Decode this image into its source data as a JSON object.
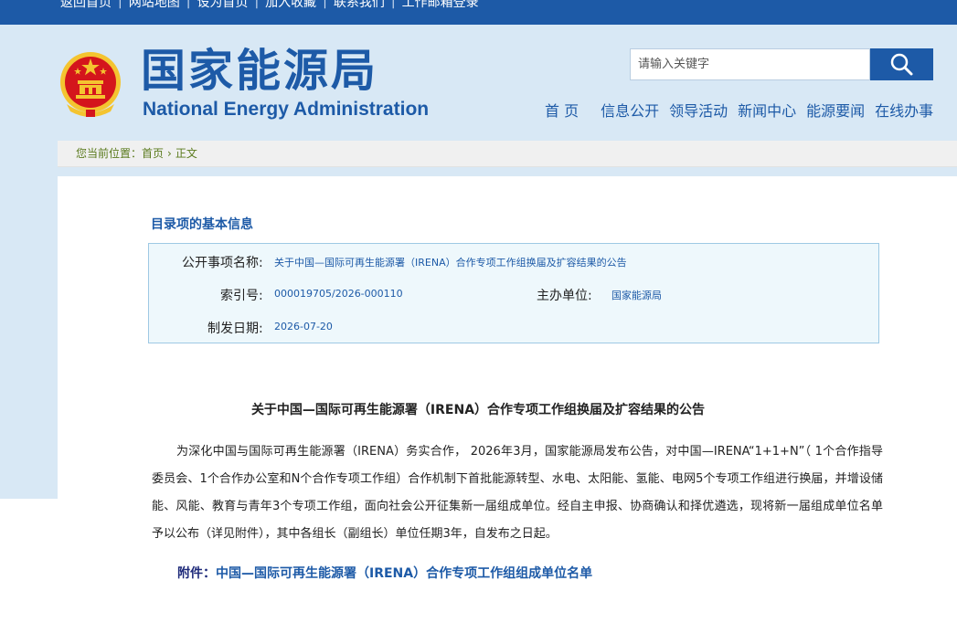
{
  "topbar": {
    "links": [
      "返回首页",
      "网站地图",
      "设为首页",
      "加入收藏",
      "联系我们",
      "工作邮箱登录"
    ],
    "separator": "|"
  },
  "header": {
    "logo_cn": "国家能源局",
    "logo_en": "National Energy Administration",
    "emblem_icon": "national-emblem-icon",
    "search": {
      "placeholder": "请输入关键字",
      "button_icon": "search-icon"
    },
    "nav": [
      "首 页",
      "信息公开",
      "领导活动",
      "新闻中心",
      "能源要闻",
      "在线办事"
    ]
  },
  "breadcrumb": {
    "prefix": "您当前位置：",
    "items": [
      "首页",
      "正文"
    ],
    "chevron_icon": "chevron-right-icon"
  },
  "info": {
    "title": "目录项的基本信息",
    "name_label": "公开事项名称:",
    "name_value": "关于中国—国际可再生能源署（IRENA）合作专项工作组换届及扩容结果的公告",
    "index_label": "索引号:",
    "index_value": "000019705/2026-000110",
    "host_label": "主办单位:",
    "host_value": "国家能源局",
    "date_label": "制发日期:",
    "date_value": "2026-07-20"
  },
  "article": {
    "title": "关于中国—国际可再生能源署（IRENA）合作专项工作组换届及扩容结果的公告",
    "body": "为深化中国与国际可再生能源署（IRENA）务实合作， 2026年3月，国家能源局发布公告，对中国—IRENA“1+1+N”（ 1个合作指导委员会、1个合作办公室和N个合作专项工作组）合作机制下首批能源转型、水电、太阳能、氢能、电网5个专项工作组进行换届，并增设储能、风能、教育与青年3个专项工作组，面向社会公开征集新一届组成单位。经自主申报、协商确认和择优遴选，现将新一届组成单位名单予以公布（详见附件），其中各组长（副组长）单位任期3年，自发布之日起。",
    "attachment_label": "附件：",
    "attachment_link": "中国—国际可再生能源署（IRENA）合作专项工作组组成单位名单"
  },
  "colors": {
    "brand_blue": "#1d5aa7",
    "header_bg": "#d8e8f5",
    "emblem_red": "#d4151c",
    "emblem_gold": "#f4c430",
    "breadcrumb_green": "#5a7a1c"
  }
}
